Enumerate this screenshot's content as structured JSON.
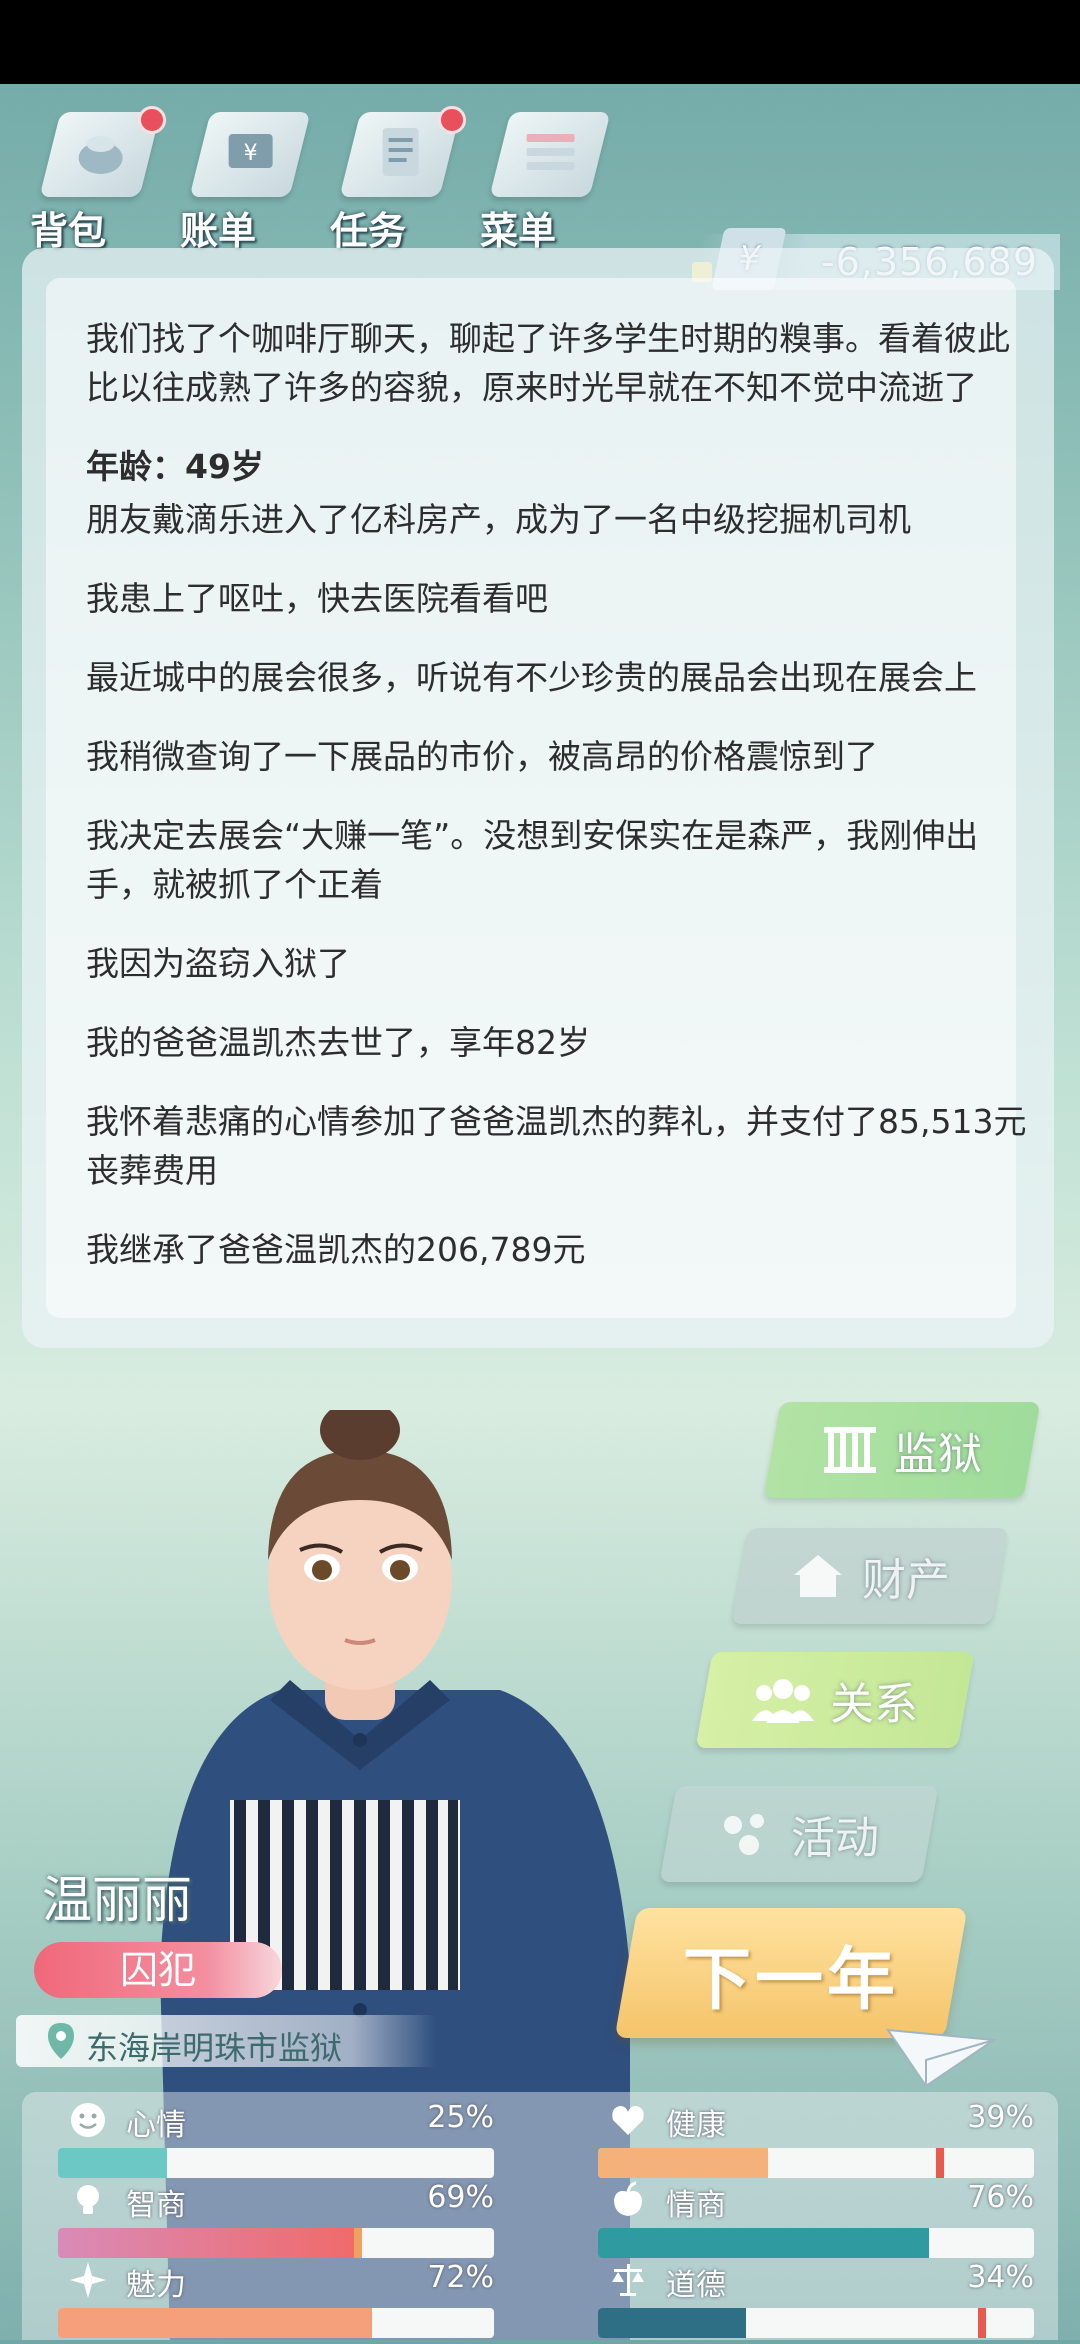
{
  "nav": {
    "items": [
      {
        "label": "背包",
        "badge": true
      },
      {
        "label": "账单",
        "badge": false
      },
      {
        "label": "任务",
        "badge": true
      },
      {
        "label": "菜单",
        "badge": false
      }
    ]
  },
  "money": {
    "currency_symbol": "¥",
    "value": "-6,356,689"
  },
  "log": [
    "我们找了个咖啡厅聊天，聊起了许多学生时期的糗事。看着彼此比以往成熟了许多的容貌，原来时光早就在不知不觉中流逝了",
    "年龄：49岁",
    "朋友戴滴乐进入了亿科房产，成为了一名中级挖掘机司机",
    "我患上了呕吐，快去医院看看吧",
    "最近城中的展会很多，听说有不少珍贵的展品会出现在展会上",
    "我稍微查询了一下展品的市价，被高昂的价格震惊到了",
    "我决定去展会“大赚一笔”。没想到安保实在是森严，我刚伸出手，就被抓了个正着",
    "我因为盗窃入狱了",
    "我的爸爸温凯杰去世了，享年82岁",
    "我怀着悲痛的心情参加了爸爸温凯杰的葬礼，并支付了85,513元丧葬费用",
    "我继承了爸爸温凯杰的206,789元"
  ],
  "side": {
    "prison": "监狱",
    "assets": "财产",
    "relations": "关系",
    "activities": "活动",
    "next_year": "下一年"
  },
  "character": {
    "name": "温丽丽",
    "role": "囚犯",
    "location": "东海岸明珠市监狱"
  },
  "stats": [
    {
      "name": "心情",
      "value": "25%",
      "level": 0.25,
      "color": "#6cc8c4",
      "icon": "smiley-icon"
    },
    {
      "name": "健康",
      "value": "39%",
      "level": 0.39,
      "color": "#f4b27a",
      "icon": "heart-icon"
    },
    {
      "name": "智商",
      "value": "69%",
      "level": 0.69,
      "color": "#d98bb8",
      "icon": "lightbulb-icon"
    },
    {
      "name": "情商",
      "value": "76%",
      "level": 0.76,
      "color": "#2f9aa0",
      "icon": "apple-icon"
    },
    {
      "name": "魅力",
      "value": "72%",
      "level": 0.72,
      "color": "#f5a07a",
      "icon": "sparkle-icon"
    },
    {
      "name": "道德",
      "value": "34%",
      "level": 0.34,
      "color": "#2f6f86",
      "icon": "scales-icon"
    }
  ]
}
